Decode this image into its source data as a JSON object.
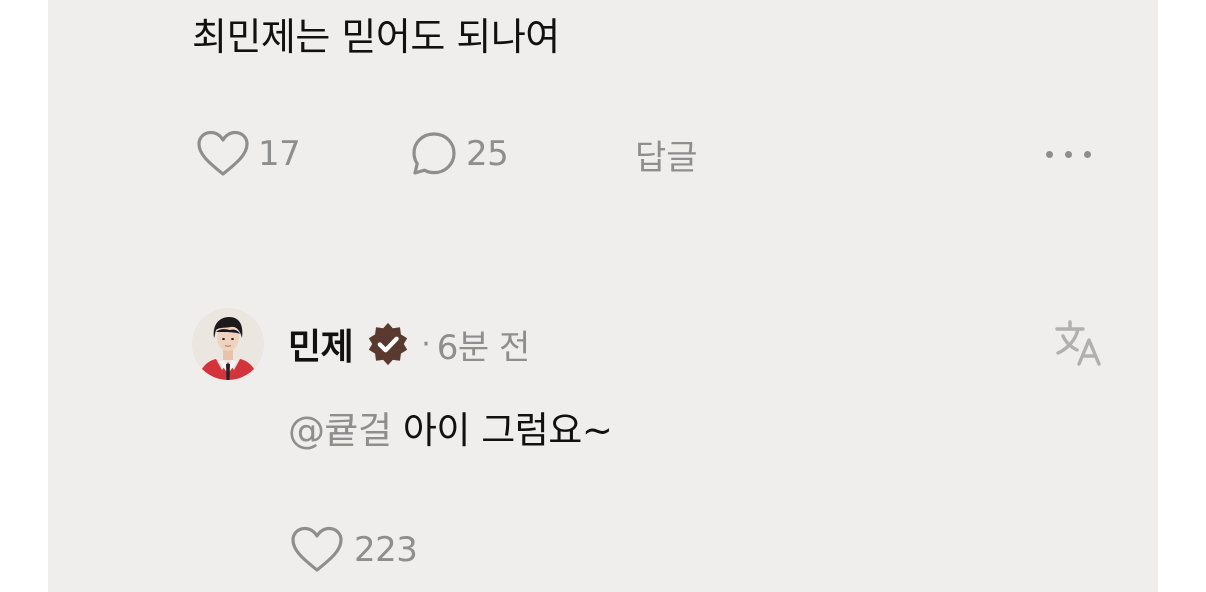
{
  "post": {
    "text": "최민제는 믿어도 되나여",
    "like_count": "17",
    "comment_count": "25",
    "reply_label": "답글",
    "more_icon": "more-horizontal-icon"
  },
  "reply": {
    "author": "민제",
    "verified_icon": "verified-badge-icon",
    "verified_color": "#5a3a2e",
    "separator": "·",
    "timestamp": "6분 전",
    "translate_icon": "translate-icon",
    "mention": "@큩걸",
    "text": " 아이 그럼요~",
    "like_count": "223"
  },
  "colors": {
    "background": "#f0eeed",
    "text": "#111111",
    "muted": "#8e8e8e"
  }
}
